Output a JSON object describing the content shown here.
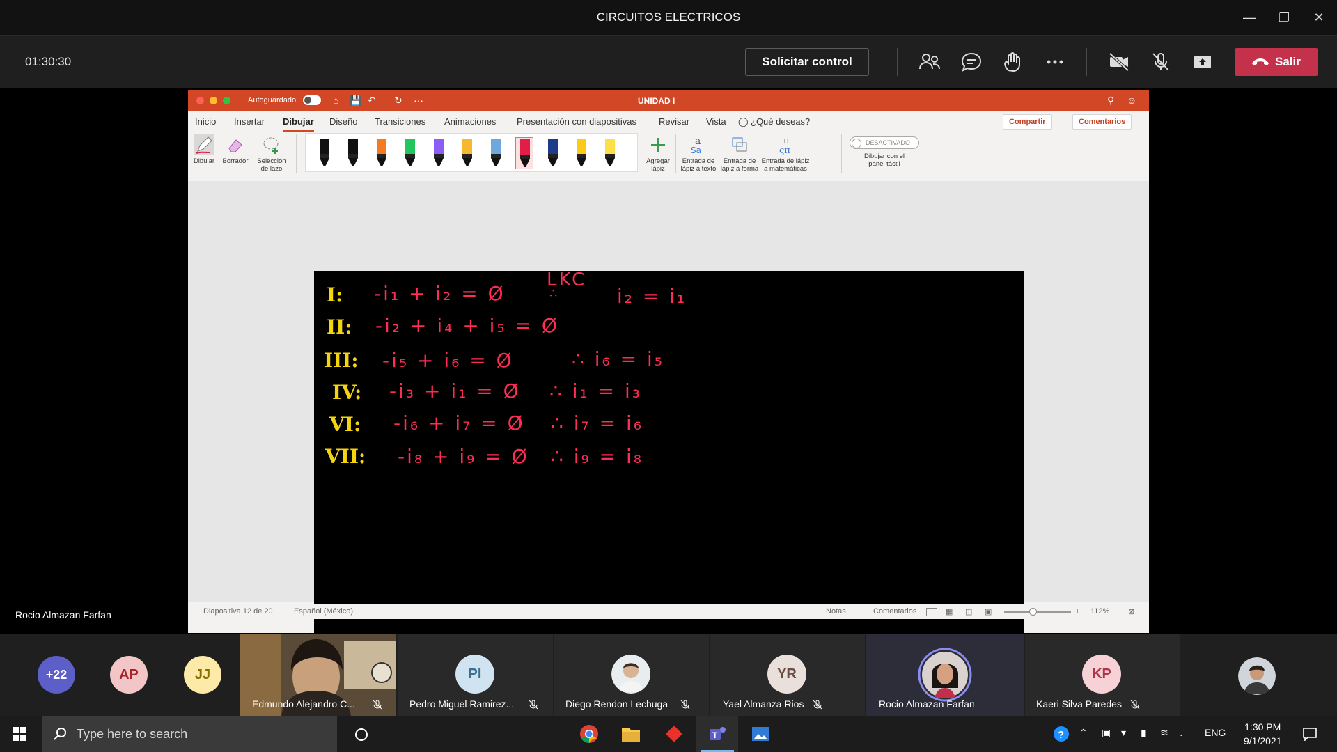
{
  "window": {
    "title": "CIRCUITOS ELECTRICOS"
  },
  "meeting": {
    "timer": "01:30:30",
    "request_control": "Solicitar control",
    "leave": "Salir",
    "presenter_name": "Rocio Almazan Farfan"
  },
  "ppt": {
    "autosave_label": "Autoguardado",
    "autosave_state": "o",
    "doc_name": "UNIDAD I",
    "tabs": [
      "Inicio",
      "Insertar",
      "Dibujar",
      "Diseño",
      "Transiciones",
      "Animaciones",
      "Presentación con diapositivas",
      "Revisar",
      "Vista"
    ],
    "active_tab": "Dibujar",
    "tell_me": "¿Qué deseas?",
    "share": "Compartir",
    "comments": "Comentarios",
    "tools": {
      "draw": "Dibujar",
      "eraser": "Borrador",
      "lasso": [
        "Selección",
        "de lazo"
      ],
      "add_pen": [
        "Agregar",
        "lápiz"
      ],
      "ink_text": [
        "Entrada de",
        "lápiz a texto"
      ],
      "ink_shape": [
        "Entrada de",
        "lápiz a forma"
      ],
      "ink_math": [
        "Entrada de lápiz",
        "a matemáticas"
      ],
      "touch_toggle": "DESACTIVADO",
      "touch_label": [
        "Dibujar con el",
        "panel táctil"
      ]
    },
    "pens": [
      "#111111",
      "#111111",
      "#f47b20",
      "#22c55e",
      "#8b5cf6",
      "#f5b82e",
      "#6fa8dc",
      "#e11d48",
      "#1e3a8a",
      "#facc15",
      "#fde047"
    ],
    "selected_pen": 7,
    "slide": {
      "label_lkc": "LKC",
      "rows": [
        {
          "node": "I:",
          "eq": "-i₁ + i₂ = Ø",
          "result": "i₂ = i₁"
        },
        {
          "node": "II:",
          "eq": "-i₂ + i₄ + i₅ = Ø",
          "result": ""
        },
        {
          "node": "III:",
          "eq": "-i₅ + i₆ = Ø",
          "result": "∴ i₆ = i₅"
        },
        {
          "node": "IV:",
          "eq": "-i₃ + i₁ = Ø",
          "result": "∴ i₁ = i₃"
        },
        {
          "node": "VI:",
          "eq": "-i₆ + i₇ = Ø",
          "result": "∴ i₇ = i₆"
        },
        {
          "node": "VII:",
          "eq": "-i₈ + i₉ = Ø",
          "result": "∴ i₉ = i₈"
        }
      ]
    },
    "status": {
      "slide_of": "Diapositiva 12 de 20",
      "language": "Español (México)",
      "notes": "Notas",
      "comments": "Comentarios",
      "zoom": "112%"
    }
  },
  "participants": {
    "overflow": "+22",
    "tiles": [
      {
        "initials": "AP",
        "name": "",
        "color": "#f2c5c7",
        "text_color": "#a4262c"
      },
      {
        "initials": "JJ",
        "name": "",
        "color": "#fde9a8",
        "text_color": "#8a6d00"
      },
      {
        "initials": "",
        "name": "Edmundo Alejandro C...",
        "video": true
      },
      {
        "initials": "PI",
        "name": "Pedro Miguel Ramirez...",
        "color": "#cfe3f0",
        "text_color": "#3b6e8f"
      },
      {
        "initials": "",
        "name": "Diego Rendon Lechuga",
        "photo": true
      },
      {
        "initials": "YR",
        "name": "Yael Almanza Rios",
        "color": "#e9e0dc",
        "text_color": "#6b4f44"
      },
      {
        "initials": "",
        "name": "Rocio Almazan Farfan",
        "photo": true,
        "speaking": true
      },
      {
        "initials": "KP",
        "name": "Kaeri Silva Paredes",
        "color": "#f6d1d6",
        "text_color": "#b0354a"
      }
    ]
  },
  "taskbar": {
    "search_placeholder": "Type here to search",
    "language": "ENG",
    "time": "1:30 PM",
    "date": "9/1/2021"
  },
  "colors": {
    "teams_red": "#c4314b",
    "ppt_orange": "#d24726",
    "ink_pink": "#ff2d55",
    "ink_yellow": "#f5d50e"
  }
}
